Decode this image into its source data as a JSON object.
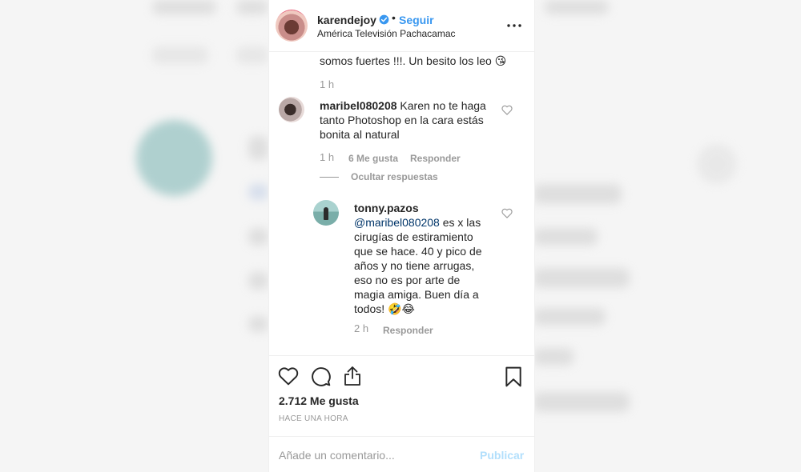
{
  "post": {
    "username": "karendejoy",
    "follow_label": "Seguir",
    "separator": "•",
    "location": "América Televisión Pachacamac"
  },
  "comments": {
    "partial_text": "somos fuertes !!!. Un besito los leo",
    "partial_emoji": "😘",
    "partial_time": "1 h",
    "c1": {
      "username": "maribel080208",
      "line1": "Karen no te haga",
      "line2": "tanto Photoshop en la cara estás",
      "line3": "bonita al natural",
      "time": "1 h",
      "likes": "6 Me gusta",
      "reply_label": "Responder"
    },
    "hide_replies_label": "Ocultar respuestas",
    "reply": {
      "username": "tonny.pazos",
      "mention": "@maribel080208",
      "line1_rest": "es x las",
      "line2": "cirugías de estiramiento",
      "line3": "que se hace. 40 y pico de",
      "line4": "años y no tiene arrugas,",
      "line5": "eso no es por arte de",
      "line6": "magia amiga. Buen día a",
      "line7": "todos!",
      "emojis": "🤣😂",
      "time": "2 h",
      "reply_label": "Responder"
    }
  },
  "actions": {
    "likes_label": "2.712 Me gusta",
    "time_ago": "HACE UNA HORA",
    "comment_placeholder": "Añade un comentario...",
    "publish_label": "Publicar"
  },
  "colors": {
    "accent": "#3897f0",
    "publish_disabled": "#b2dffc",
    "text": "#262626",
    "muted": "#999999"
  },
  "icons": [
    "verified-badge-icon",
    "more-options-icon",
    "heart-icon",
    "comment-icon",
    "share-icon",
    "bookmark-icon"
  ]
}
